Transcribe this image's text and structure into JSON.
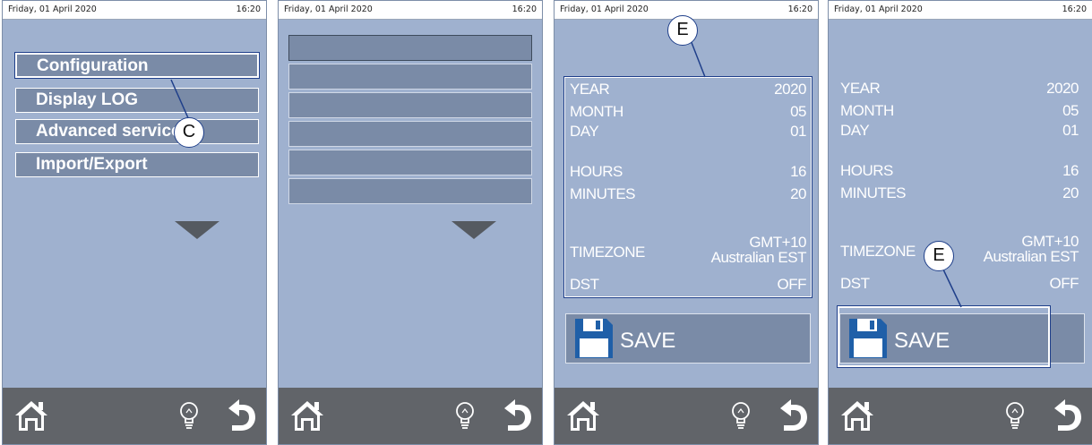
{
  "status": {
    "date": "Friday, 01 April 2020",
    "time": "16:20"
  },
  "panel1": {
    "menu": [
      {
        "label": "Configuration",
        "selected": true
      },
      {
        "label": "Display LOG",
        "selected": false
      },
      {
        "label": "Advanced services",
        "selected": false
      },
      {
        "label": "Import/Export",
        "selected": false
      }
    ],
    "callout": "C"
  },
  "panel2": {
    "empty_button_count": 6
  },
  "panel3": {
    "rows": {
      "year": {
        "label": "YEAR",
        "value": "2020"
      },
      "month": {
        "label": "MONTH",
        "value": "05"
      },
      "day": {
        "label": "DAY",
        "value": "01"
      },
      "hours": {
        "label": "HOURS",
        "value": "16"
      },
      "minutes": {
        "label": "MINUTES",
        "value": "20"
      },
      "timezone": {
        "label": "TIMEZONE",
        "value_line1": "GMT+10",
        "value_line2": "Australian EST"
      },
      "dst": {
        "label": "DST",
        "value": "OFF"
      }
    },
    "save_label": "SAVE",
    "callout": "E"
  },
  "panel4": {
    "rows": {
      "year": {
        "label": "YEAR",
        "value": "2020"
      },
      "month": {
        "label": "MONTH",
        "value": "05"
      },
      "day": {
        "label": "DAY",
        "value": "01"
      },
      "hours": {
        "label": "HOURS",
        "value": "16"
      },
      "minutes": {
        "label": "MINUTES",
        "value": "20"
      },
      "timezone": {
        "label": "TIMEZONE",
        "value_line1": "GMT+10",
        "value_line2": "Australian EST"
      },
      "dst": {
        "label": "DST",
        "value": "OFF"
      }
    },
    "save_label": "SAVE",
    "callout": "E"
  },
  "bottom_icons": [
    "home-icon",
    "lightbulb-icon",
    "back-arrow-icon"
  ],
  "colors": {
    "panel_bg": "#9fb1cf",
    "button_bg": "#7a8ba7",
    "bottom_bar": "#616469",
    "callout_border": "#1f3f8a"
  }
}
